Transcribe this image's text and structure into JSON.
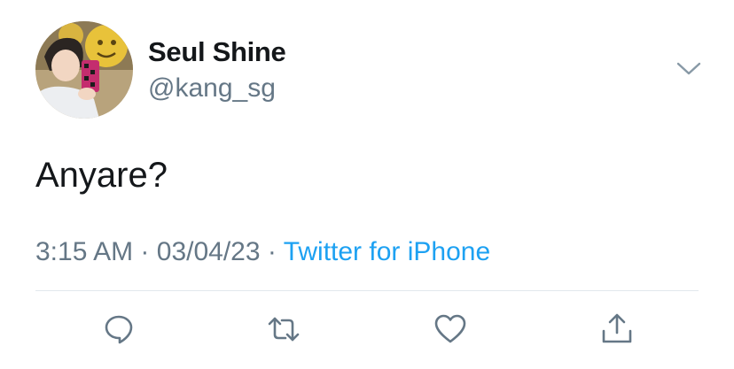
{
  "tweet": {
    "author": {
      "display_name": "Seul Shine",
      "handle": "@kang_sg"
    },
    "text": "Anyare?",
    "time": "3:15 AM",
    "separator_1": "·",
    "date": "03/04/23",
    "separator_2": "·",
    "source": "Twitter for iPhone"
  },
  "icons": {
    "menu": "chevron-down-icon",
    "reply": "reply-icon",
    "retweet": "retweet-icon",
    "like": "heart-icon",
    "share": "share-icon"
  },
  "colors": {
    "text_primary": "#14171a",
    "text_secondary": "#657786",
    "link": "#1da1f2",
    "divider": "#e1e8ed",
    "icon": "#657786"
  }
}
